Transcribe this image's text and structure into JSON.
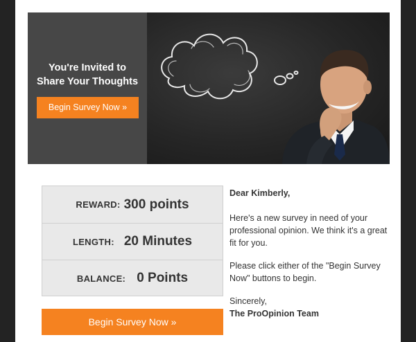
{
  "banner": {
    "heading_line1": "You're Invited to",
    "heading_line2": "Share Your Thoughts",
    "button_label": "Begin Survey Now »"
  },
  "stats": {
    "reward": {
      "label": "REWARD:",
      "value": "300 points"
    },
    "length": {
      "label": "LENGTH:",
      "value": "20 Minutes"
    },
    "balance": {
      "label": "BALANCE:",
      "value": "0 Points"
    }
  },
  "cta": {
    "label": "Begin Survey Now »"
  },
  "letter": {
    "greeting": "Dear Kimberly,",
    "paragraph1": "Here's a new survey in need of your professional opinion. We think it's a great fit for you.",
    "paragraph2": "Please click either of the \"Begin Survey Now\" buttons to begin.",
    "signoff": "Sincerely,",
    "team": "The ProOpinion Team"
  },
  "colors": {
    "accent": "#f58220",
    "frame": "#232323",
    "banner_panel": "#474747",
    "stats_background": "#e9e9e9"
  }
}
